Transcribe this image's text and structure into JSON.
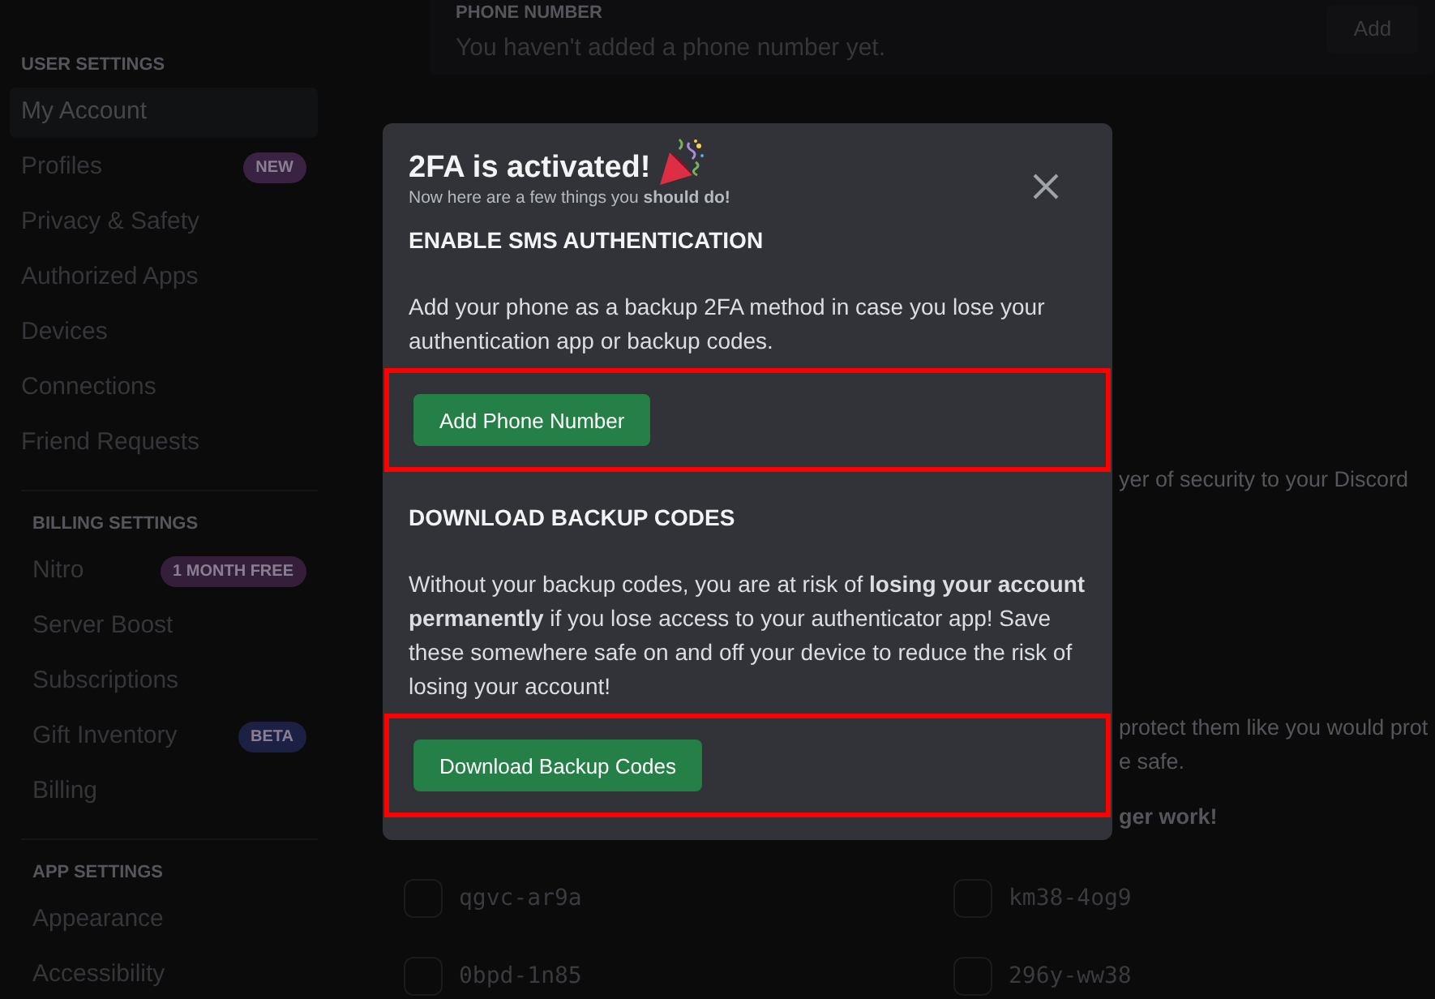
{
  "sidebar": {
    "groups": [
      {
        "title": "USER SETTINGS",
        "items": [
          {
            "label": "My Account",
            "selected": true
          },
          {
            "label": "Profiles",
            "selected": false,
            "badge": {
              "text": "NEW",
              "color": "#3a2342"
            }
          },
          {
            "label": "Privacy & Safety",
            "selected": false
          },
          {
            "label": "Authorized Apps",
            "selected": false
          },
          {
            "label": "Devices",
            "selected": false
          },
          {
            "label": "Connections",
            "selected": false
          },
          {
            "label": "Friend Requests",
            "selected": false
          }
        ]
      },
      {
        "title": "BILLING SETTINGS",
        "items": [
          {
            "label": "Nitro",
            "selected": false,
            "badge": {
              "text": "1 MONTH FREE",
              "color": "#351e3a"
            }
          },
          {
            "label": "Server Boost",
            "selected": false
          },
          {
            "label": "Subscriptions",
            "selected": false
          },
          {
            "label": "Gift Inventory",
            "selected": false,
            "badge": {
              "text": "BETA",
              "color": "#1c2143"
            }
          },
          {
            "label": "Billing",
            "selected": false
          }
        ]
      },
      {
        "title": "APP SETTINGS",
        "items": [
          {
            "label": "Appearance",
            "selected": false
          },
          {
            "label": "Accessibility",
            "selected": false
          }
        ]
      }
    ]
  },
  "phone": {
    "label": "PHONE NUMBER",
    "text": "You haven't added a phone number yet.",
    "button": "Add"
  },
  "background_texts": [
    {
      "text": "yer of security to your Discord",
      "bold": false
    },
    {
      "text": "protect them like you would prot",
      "bold": false
    },
    {
      "text": "e safe.",
      "bold": false
    },
    {
      "text": "ger work!",
      "bold": true
    }
  ],
  "backup_codes": [
    {
      "code": "qgvc-ar9a",
      "checked": false
    },
    {
      "code": "km38-4og9",
      "checked": false
    },
    {
      "code": "0bpd-1n85",
      "checked": false
    },
    {
      "code": "296y-ww38",
      "checked": false
    }
  ],
  "modal": {
    "title": "2FA is activated!",
    "subtitle": "Now here are a few things you **should do!**",
    "sections": [
      {
        "heading": "ENABLE SMS AUTHENTICATION",
        "text": "Add your phone as a backup 2FA method in case you lose your authentication app or backup codes.",
        "button": "Add Phone Number",
        "highlighted": true
      },
      {
        "heading": "DOWNLOAD BACKUP CODES",
        "text": "Without your backup codes, you are at risk of **losing your account permanently** if you lose access to your authenticator app! Save these somewhere safe on and off your device to reduce the risk of losing your account!",
        "button": "Download Backup Codes",
        "highlighted": true
      }
    ]
  }
}
